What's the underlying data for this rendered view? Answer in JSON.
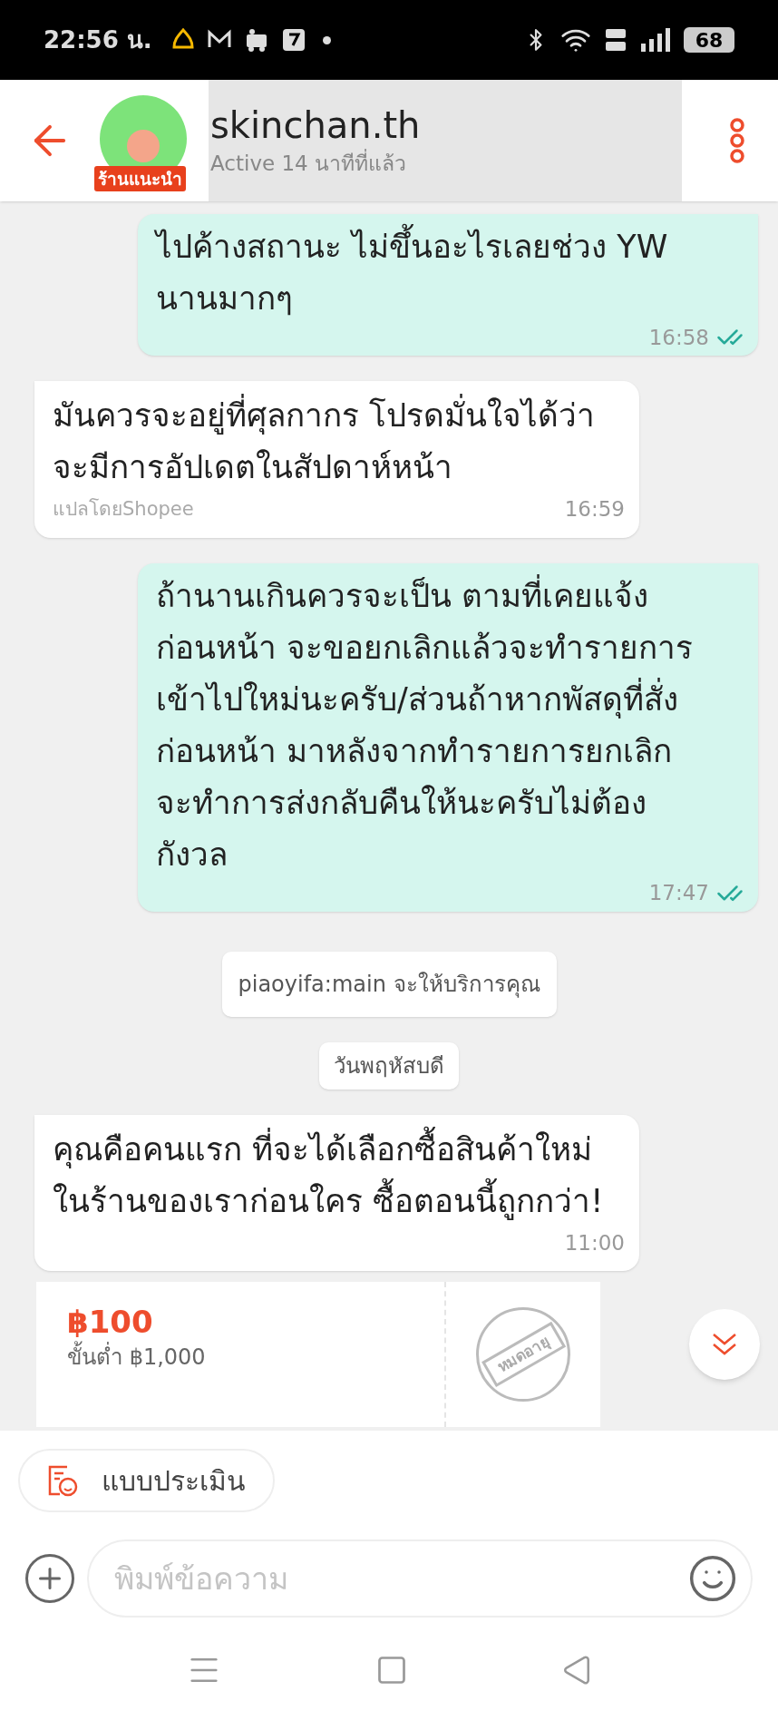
{
  "status_bar": {
    "time": "22:56 น.",
    "battery": "68"
  },
  "header": {
    "shop_name": "skinchan.th",
    "badge": "ร้านแนะนำ",
    "status": "Active 14 นาทีที่แล้ว"
  },
  "messages": [
    {
      "kind": "outgoing",
      "text": "ไปค้างสถานะ ไม่ขึ้นอะไรเลยช่วง YW\nนานมากๆ",
      "time": "16:58",
      "read": true
    },
    {
      "kind": "incoming",
      "text": "มันควรจะอยู่ที่ศุลกากร โปรดมั่นใจได้ว่า\nจะมีการอัปเดตในสัปดาห์หน้า",
      "note": "แปลโดยShopee",
      "time": "16:59"
    },
    {
      "kind": "outgoing",
      "text": "ถ้านานเกินควรจะเป็น ตามที่เคยแจ้ง\nก่อนหน้า จะขอยกเลิกแล้วจะทำรายการ\nเข้าไปใหม่นะครับ/ส่วนถ้าหากพัสดุที่สั่ง\nก่อนหน้า มาหลังจากทำรายการยกเลิก\nจะทำการส่งกลับคืนให้นะครับไม่ต้อง\nกังวล",
      "time": "17:47",
      "read": true
    },
    {
      "kind": "system",
      "text": "piaoyifa:main จะให้บริการคุณ"
    },
    {
      "kind": "date",
      "text": "วันพฤหัสบดี"
    },
    {
      "kind": "incoming",
      "text": "คุณคือคนแรก ที่จะได้เลือกซื้อสินค้าใหม่\nในร้านของเราก่อนใคร ซื้อตอนนี้ถูกกว่า!",
      "time": "11:00"
    },
    {
      "kind": "voucher",
      "amount": "฿100",
      "minimum": "ขั้นต่ำ ฿1,000",
      "stamp": "หมดอายุ"
    }
  ],
  "evaluation_chip": {
    "label": "แบบประเมิน"
  },
  "composer": {
    "placeholder": "พิมพ์ข้อความ"
  }
}
